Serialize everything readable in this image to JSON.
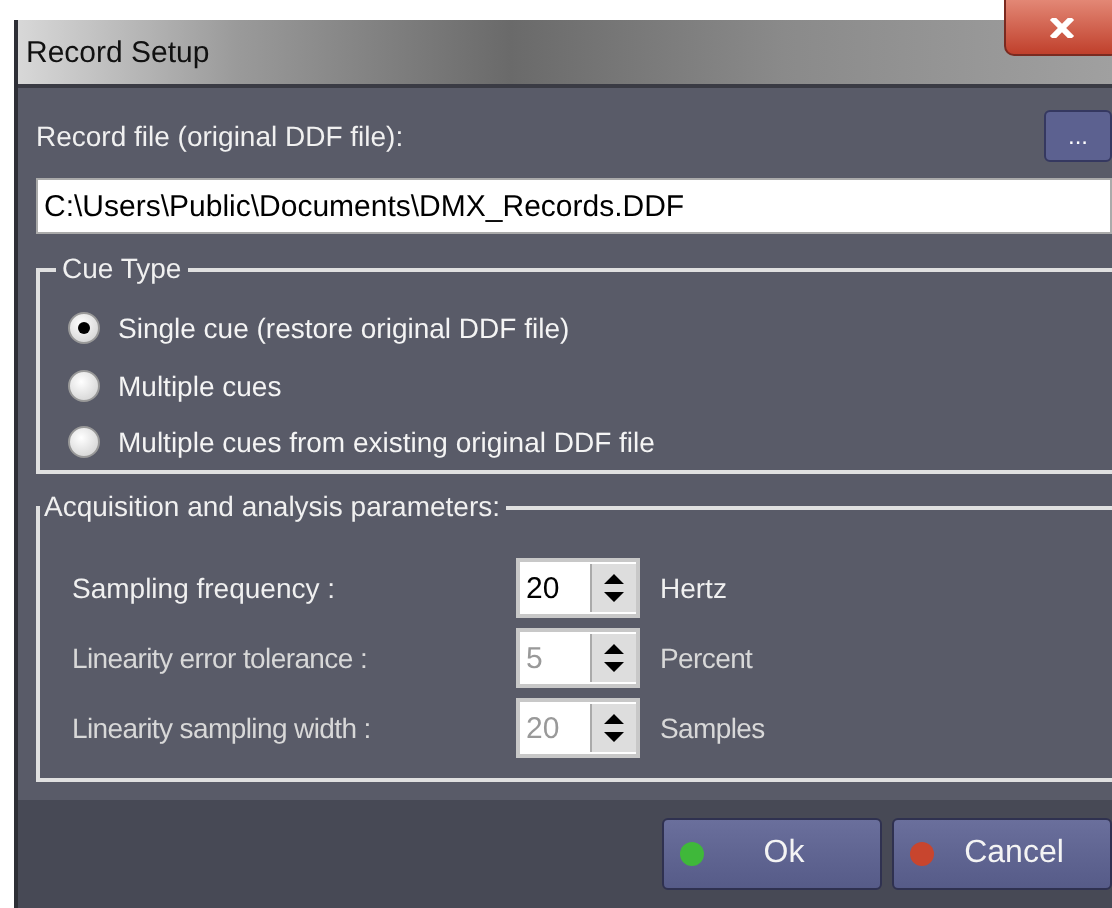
{
  "window": {
    "title": "Record Setup"
  },
  "record_file": {
    "label": "Record file (original DDF file):",
    "browse_button": "...",
    "value": "C:\\Users\\Public\\Documents\\DMX_Records.DDF"
  },
  "cue_type": {
    "title": "Cue Type",
    "options": [
      {
        "label": "Single cue (restore original DDF file)",
        "selected": true
      },
      {
        "label": "Multiple cues",
        "selected": false
      },
      {
        "label": "Multiple cues from existing original DDF file",
        "selected": false
      }
    ]
  },
  "parameters": {
    "title": "Acquisition and analysis parameters:",
    "rows": [
      {
        "label": "Sampling frequency :",
        "value": "20",
        "unit": "Hertz",
        "disabled": false
      },
      {
        "label": "Linearity error tolerance :",
        "value": "5",
        "unit": "Percent",
        "disabled": true
      },
      {
        "label": "Linearity sampling width :",
        "value": "20",
        "unit": "Samples",
        "disabled": true
      }
    ]
  },
  "buttons": [
    {
      "label": "Ok",
      "color": "#3fb83a"
    },
    {
      "label": "Cancel",
      "color": "#c8452e"
    }
  ]
}
